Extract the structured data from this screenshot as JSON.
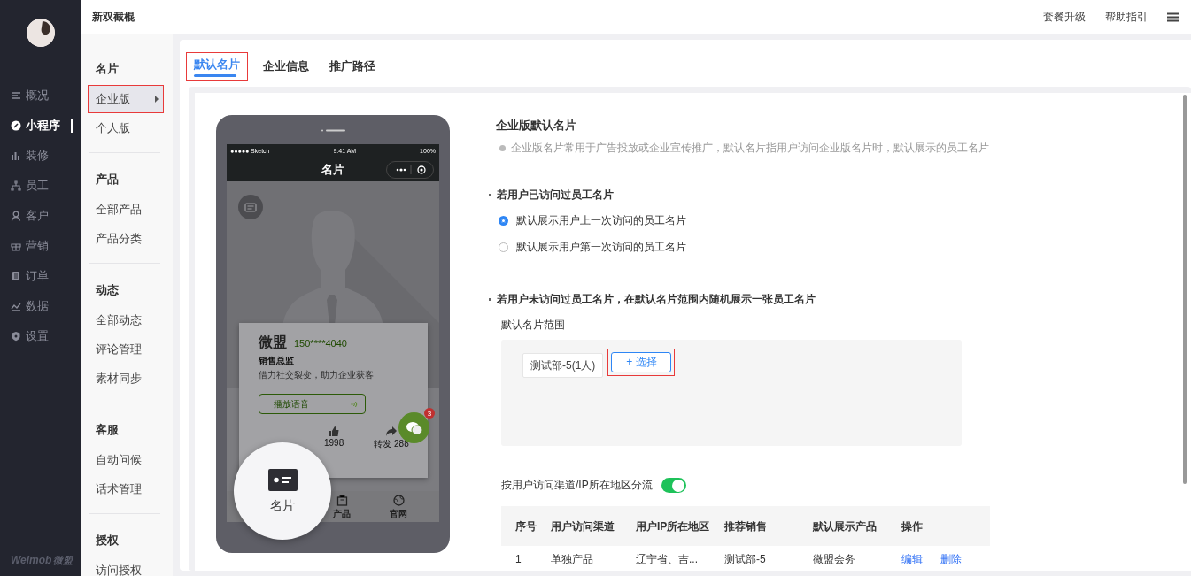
{
  "sidebar": {
    "items": [
      {
        "label": "概况",
        "selected": false
      },
      {
        "label": "小程序",
        "selected": true
      },
      {
        "label": "装修",
        "selected": false
      },
      {
        "label": "员工",
        "selected": false
      },
      {
        "label": "客户",
        "selected": false
      },
      {
        "label": "营销",
        "selected": false
      },
      {
        "label": "订单",
        "selected": false
      },
      {
        "label": "数据",
        "selected": false
      },
      {
        "label": "设置",
        "selected": false
      }
    ],
    "logo": {
      "brand": "Weimob",
      "name": "微盟"
    }
  },
  "header": {
    "title": "新双截棍",
    "links": [
      "套餐升级",
      "帮助指引"
    ]
  },
  "subnav": {
    "groups": [
      {
        "title": "名片",
        "items": [
          {
            "label": "企业版",
            "selected": true,
            "highlighted": true
          },
          {
            "label": "个人版",
            "selected": false,
            "highlighted": false
          }
        ]
      },
      {
        "title": "产品",
        "items": [
          {
            "label": "全部产品",
            "selected": false,
            "highlighted": false
          },
          {
            "label": "产品分类",
            "selected": false,
            "highlighted": false
          }
        ]
      },
      {
        "title": "动态",
        "items": [
          {
            "label": "全部动态",
            "selected": false,
            "highlighted": false
          },
          {
            "label": "评论管理",
            "selected": false,
            "highlighted": false
          },
          {
            "label": "素材同步",
            "selected": false,
            "highlighted": false
          }
        ]
      },
      {
        "title": "客服",
        "items": [
          {
            "label": "自动问候",
            "selected": false,
            "highlighted": false
          },
          {
            "label": "话术管理",
            "selected": false,
            "highlighted": false
          }
        ]
      },
      {
        "title": "授权",
        "items": [
          {
            "label": "访问授权",
            "selected": false,
            "highlighted": false
          }
        ]
      }
    ]
  },
  "tabs": [
    {
      "label": "默认名片",
      "selected": true,
      "highlighted": true
    },
    {
      "label": "企业信息",
      "selected": false,
      "highlighted": false
    },
    {
      "label": "推广路径",
      "selected": false,
      "highlighted": false
    }
  ],
  "phone": {
    "status": {
      "carrier": "●●●●● Sketch",
      "time": "9:41 AM",
      "battery": "100%"
    },
    "title": "名片",
    "card": {
      "name": "微盟",
      "phone": "150****4040",
      "role": "销售总监",
      "slogan": "借力社交裂变，助力企业获客",
      "voice": "播放语音",
      "likes": "1998",
      "shares": "转发 288"
    },
    "chat_badge": "3",
    "tabbar": [
      "产品",
      "官网"
    ],
    "magnified_tab": "名片"
  },
  "form": {
    "title": "企业版默认名片",
    "hint": "企业版名片常用于广告投放或企业宣传推广，默认名片指用户访问企业版名片时，默认展示的员工名片",
    "visited": {
      "heading": "若用户已访问过员工名片",
      "options": [
        {
          "label": "默认展示用户上一次访问的员工名片",
          "selected": true
        },
        {
          "label": "默认展示用户第一次访问的员工名片",
          "selected": false
        }
      ]
    },
    "unvisited": {
      "heading": "若用户未访问过员工名片，在默认名片范围内随机展示一张员工名片",
      "range_label": "默认名片范围",
      "tags": [
        "测试部-5(1人)"
      ],
      "select_button": {
        "label": "+ 选择",
        "highlighted": true
      }
    },
    "split": {
      "label": "按用户访问渠道/IP所在地区分流",
      "on": true
    },
    "table": {
      "columns": [
        "序号",
        "用户访问渠道",
        "用户IP所在地区",
        "推荐销售",
        "默认展示产品",
        "操作"
      ],
      "rows": [
        {
          "cells": [
            "1",
            "单独产品",
            "辽宁省、吉...",
            "测试部-5",
            "微盟会务"
          ],
          "actions": [
            "编辑",
            "删除"
          ]
        }
      ]
    }
  }
}
